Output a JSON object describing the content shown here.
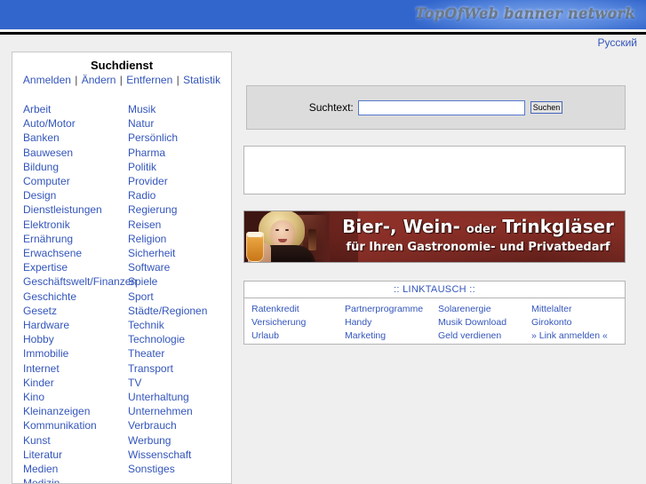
{
  "header": {
    "brand": "TopOfWeb banner network",
    "brand_color": "#3366cc"
  },
  "language": {
    "label": "Русский"
  },
  "sidebar": {
    "title": "Suchdienst",
    "nav": [
      {
        "label": "Anmelden"
      },
      {
        "label": "Ändern"
      },
      {
        "label": "Entfernen"
      },
      {
        "label": "Statistik"
      }
    ],
    "nav_separator": "|",
    "categories_left": [
      "Arbeit",
      "Auto/Motor",
      "Banken",
      "Bauwesen",
      "Bildung",
      "Computer",
      "Design",
      "Dienstleistungen",
      "Elektronik",
      "Ernährung",
      "Erwachsene",
      "Expertise",
      "Geschäftswelt/Finanzen",
      "Geschichte",
      "Gesetz",
      "Hardware",
      "Hobby",
      "Immobilie",
      "Internet",
      "Kinder",
      "Kino",
      "Kleinanzeigen",
      "Kommunikation",
      "Kunst",
      "Literatur",
      "Medien",
      "Medizin"
    ],
    "categories_right": [
      "Musik",
      "Natur",
      "Persönlich",
      "Pharma",
      "Politik",
      "Provider",
      "Radio",
      "Regierung",
      "Reisen",
      "Religion",
      "Sicherheit",
      "Software",
      "Spiele",
      "Sport",
      "Städte/Regionen",
      "Technik",
      "Technologie",
      "Theater",
      "Transport",
      "TV",
      "Unterhaltung",
      "Unternehmen",
      "Verbrauch",
      "Werbung",
      "Wissenschaft",
      "Sonstiges"
    ]
  },
  "search": {
    "label": "Suchtext:",
    "value": "",
    "placeholder": "",
    "button_label": "Suchen"
  },
  "results": {
    "content": ""
  },
  "ad": {
    "line1_part1": "Bier-, Wein-",
    "line1_small": "oder",
    "line1_part2": "Trinkgläser",
    "line2": "für Ihren Gastronomie- und Privatbedarf",
    "bg_color": "#6d241e"
  },
  "linkexchange": {
    "header": ":: LINKTAUSCH ::",
    "columns": [
      [
        "Ratenkredit",
        "Versicherung",
        "Urlaub"
      ],
      [
        "Partnerprogramme",
        "Handy",
        "Marketing"
      ],
      [
        "Solarenergie",
        "Musik Download",
        "Geld verdienen"
      ],
      [
        "Mittelalter",
        "Girokonto",
        "» Link anmelden «"
      ]
    ]
  }
}
